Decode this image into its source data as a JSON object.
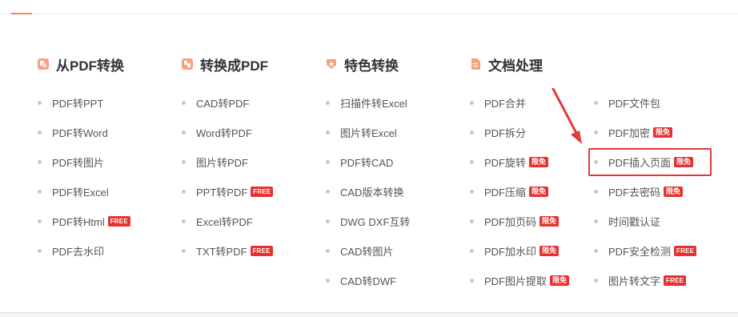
{
  "columns": [
    {
      "title": "从PDF转换",
      "icon": "pdf-convert-icon",
      "icon_color": "#f6a27a",
      "items": [
        {
          "label": "PDF转PPT"
        },
        {
          "label": "PDF转Word"
        },
        {
          "label": "PDF转图片"
        },
        {
          "label": "PDF转Excel"
        },
        {
          "label": "PDF转Html",
          "badge": "FREE"
        },
        {
          "label": "PDF去水印"
        }
      ]
    },
    {
      "title": "转换成PDF",
      "icon": "to-pdf-icon",
      "icon_color": "#f6a27a",
      "items": [
        {
          "label": "CAD转PDF"
        },
        {
          "label": "Word转PDF"
        },
        {
          "label": "图片转PDF"
        },
        {
          "label": "PPT转PDF",
          "badge": "FREE"
        },
        {
          "label": "Excel转PDF"
        },
        {
          "label": "TXT转PDF",
          "badge": "FREE"
        }
      ]
    },
    {
      "title": "特色转换",
      "icon": "star-shield-icon",
      "icon_color": "#f6a27a",
      "items": [
        {
          "label": "扫描件转Excel"
        },
        {
          "label": "图片转Excel"
        },
        {
          "label": "PDF转CAD"
        },
        {
          "label": "CAD版本转换"
        },
        {
          "label": "DWG DXF互转"
        },
        {
          "label": "CAD转图片"
        },
        {
          "label": "CAD转DWF"
        }
      ]
    },
    {
      "title": "文档处理",
      "icon": "document-icon",
      "icon_color": "#f6a27a",
      "items": [
        {
          "label": "PDF合并"
        },
        {
          "label": "PDF拆分"
        },
        {
          "label": "PDF旋转",
          "badge": "限免"
        },
        {
          "label": "PDF压缩",
          "badge": "限免"
        },
        {
          "label": "PDF加页码",
          "badge": "限免"
        },
        {
          "label": "PDF加水印",
          "badge": "限免"
        },
        {
          "label": "PDF图片提取",
          "badge": "限免"
        }
      ]
    },
    {
      "title": "",
      "icon": "",
      "items": [
        {
          "label": "PDF文件包"
        },
        {
          "label": "PDF加密",
          "badge": "限免"
        },
        {
          "label": "PDF插入页面",
          "badge": "限免"
        },
        {
          "label": "PDF去密码",
          "badge": "限免"
        },
        {
          "label": "时间戳认证"
        },
        {
          "label": "PDF安全检测",
          "badge": "FREE"
        },
        {
          "label": "图片转文字",
          "badge": "FREE"
        }
      ]
    }
  ],
  "colors": {
    "badge": "#e6312e",
    "accent": "#f08a5d",
    "highlight": "#e33b3a"
  }
}
